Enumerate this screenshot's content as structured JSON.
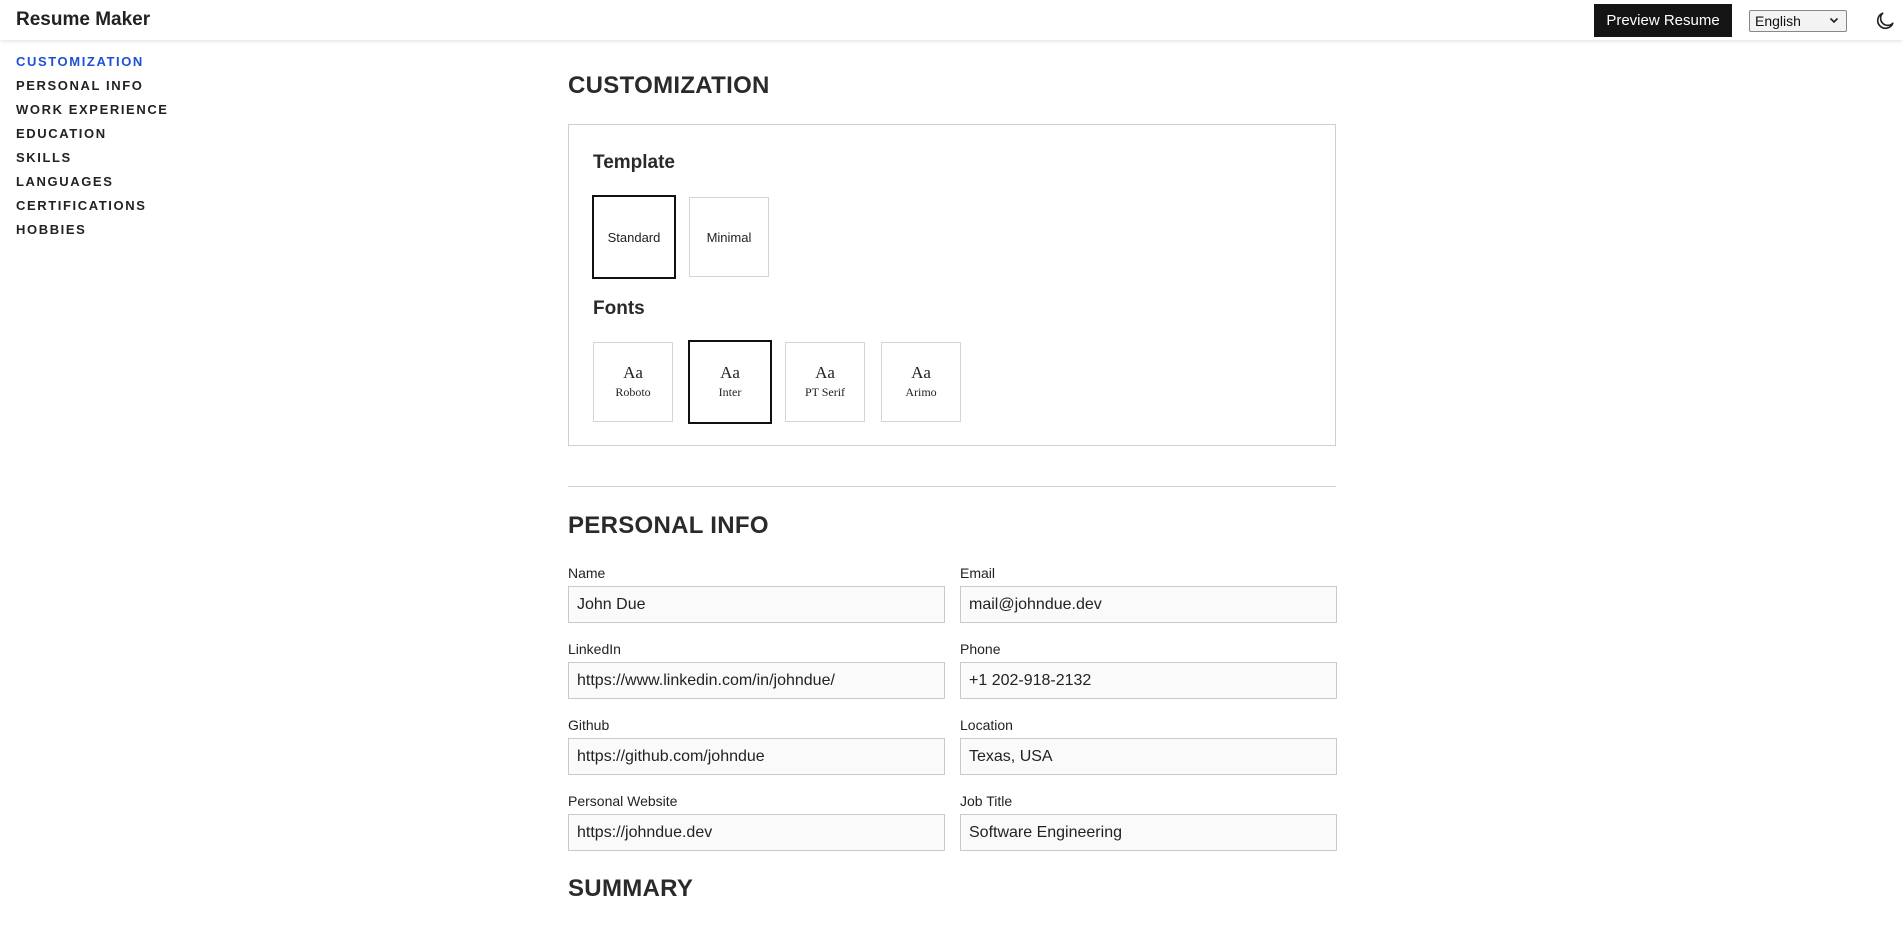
{
  "app": {
    "title": "Resume Maker"
  },
  "header": {
    "preview_label": "Preview Resume",
    "language": "English"
  },
  "sidebar": {
    "items": [
      {
        "label": "CUSTOMIZATION",
        "active": true
      },
      {
        "label": "PERSONAL INFO"
      },
      {
        "label": "WORK EXPERIENCE"
      },
      {
        "label": "EDUCATION"
      },
      {
        "label": "SKILLS"
      },
      {
        "label": "LANGUAGES"
      },
      {
        "label": "CERTIFICATIONS"
      },
      {
        "label": "HOBBIES"
      }
    ]
  },
  "customization": {
    "title": "CUSTOMIZATION",
    "template_heading": "Template",
    "templates": [
      {
        "label": "Standard",
        "selected": true
      },
      {
        "label": "Minimal"
      }
    ],
    "fonts_heading": "Fonts",
    "fonts": [
      {
        "sample": "Aa",
        "name": "Roboto"
      },
      {
        "sample": "Aa",
        "name": "Inter",
        "selected": true
      },
      {
        "sample": "Aa",
        "name": "PT Serif"
      },
      {
        "sample": "Aa",
        "name": "Arimo"
      }
    ]
  },
  "personal_info": {
    "title": "PERSONAL INFO",
    "fields": {
      "name": {
        "label": "Name",
        "value": "John Due"
      },
      "email": {
        "label": "Email",
        "value": "mail@johndue.dev"
      },
      "linkedin": {
        "label": "LinkedIn",
        "value": "https://www.linkedin.com/in/johndue/"
      },
      "phone": {
        "label": "Phone",
        "value": "+1 202-918-2132"
      },
      "github": {
        "label": "Github",
        "value": "https://github.com/johndue"
      },
      "location": {
        "label": "Location",
        "value": "Texas, USA"
      },
      "website": {
        "label": "Personal Website",
        "value": "https://johndue.dev"
      },
      "job_title": {
        "label": "Job Title",
        "value": "Software Engineering"
      }
    }
  },
  "summary": {
    "title": "SUMMARY"
  },
  "colors": {
    "accent": "#1f4fd8",
    "button_bg": "#141414"
  },
  "icons": {
    "language_chevron": "chevron-down-icon",
    "theme": "moon-icon"
  }
}
